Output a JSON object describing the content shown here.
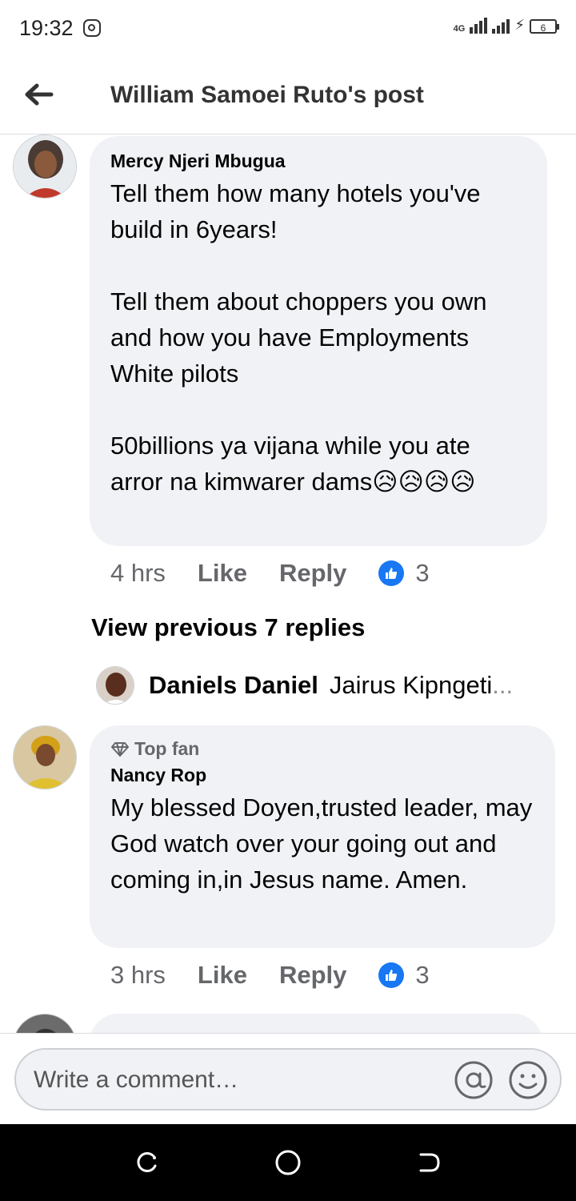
{
  "status_bar": {
    "time": "19:32",
    "network": "4G",
    "battery": "6"
  },
  "header": {
    "title": "William Samoei Ruto's post"
  },
  "comments": [
    {
      "author": "Mercy Njeri Mbugua",
      "text": "Tell them how many hotels you've build in 6years!\n\nTell them about choppers you own and how you have Employments White pilots\n\n50billions ya vijana while you ate arror na kimwarer dams😥😥😥😥",
      "time": "4 hrs",
      "like_label": "Like",
      "reply_label": "Reply",
      "reactions": "3"
    },
    {
      "badge": "Top fan",
      "author": "Nancy Rop",
      "text": "My blessed Doyen,trusted leader, may God watch over your going out and coming in,in Jesus name. Amen.",
      "time": "3 hrs",
      "like_label": "Like",
      "reply_label": "Reply",
      "reactions": "3"
    }
  ],
  "view_previous": "View previous 7 replies",
  "reply_preview": {
    "author": "Daniels Daniel",
    "snippet": "Jairus Kipngeti",
    "ellipsis": "..."
  },
  "composer": {
    "placeholder": "Write a comment…"
  },
  "colors": {
    "accent": "#1877f2",
    "bubble": "#f0f2f5",
    "muted": "#65676b"
  }
}
